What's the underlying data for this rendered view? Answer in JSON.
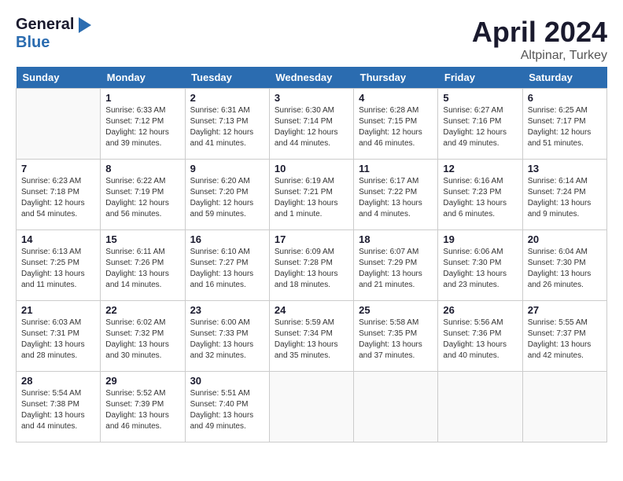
{
  "header": {
    "logo_general": "General",
    "logo_blue": "Blue",
    "title": "April 2024",
    "subtitle": "Altpinar, Turkey"
  },
  "calendar": {
    "days_of_week": [
      "Sunday",
      "Monday",
      "Tuesday",
      "Wednesday",
      "Thursday",
      "Friday",
      "Saturday"
    ],
    "weeks": [
      [
        {
          "day": "",
          "info": ""
        },
        {
          "day": "1",
          "sunrise": "Sunrise: 6:33 AM",
          "sunset": "Sunset: 7:12 PM",
          "daylight": "Daylight: 12 hours and 39 minutes."
        },
        {
          "day": "2",
          "sunrise": "Sunrise: 6:31 AM",
          "sunset": "Sunset: 7:13 PM",
          "daylight": "Daylight: 12 hours and 41 minutes."
        },
        {
          "day": "3",
          "sunrise": "Sunrise: 6:30 AM",
          "sunset": "Sunset: 7:14 PM",
          "daylight": "Daylight: 12 hours and 44 minutes."
        },
        {
          "day": "4",
          "sunrise": "Sunrise: 6:28 AM",
          "sunset": "Sunset: 7:15 PM",
          "daylight": "Daylight: 12 hours and 46 minutes."
        },
        {
          "day": "5",
          "sunrise": "Sunrise: 6:27 AM",
          "sunset": "Sunset: 7:16 PM",
          "daylight": "Daylight: 12 hours and 49 minutes."
        },
        {
          "day": "6",
          "sunrise": "Sunrise: 6:25 AM",
          "sunset": "Sunset: 7:17 PM",
          "daylight": "Daylight: 12 hours and 51 minutes."
        }
      ],
      [
        {
          "day": "7",
          "sunrise": "Sunrise: 6:23 AM",
          "sunset": "Sunset: 7:18 PM",
          "daylight": "Daylight: 12 hours and 54 minutes."
        },
        {
          "day": "8",
          "sunrise": "Sunrise: 6:22 AM",
          "sunset": "Sunset: 7:19 PM",
          "daylight": "Daylight: 12 hours and 56 minutes."
        },
        {
          "day": "9",
          "sunrise": "Sunrise: 6:20 AM",
          "sunset": "Sunset: 7:20 PM",
          "daylight": "Daylight: 12 hours and 59 minutes."
        },
        {
          "day": "10",
          "sunrise": "Sunrise: 6:19 AM",
          "sunset": "Sunset: 7:21 PM",
          "daylight": "Daylight: 13 hours and 1 minute."
        },
        {
          "day": "11",
          "sunrise": "Sunrise: 6:17 AM",
          "sunset": "Sunset: 7:22 PM",
          "daylight": "Daylight: 13 hours and 4 minutes."
        },
        {
          "day": "12",
          "sunrise": "Sunrise: 6:16 AM",
          "sunset": "Sunset: 7:23 PM",
          "daylight": "Daylight: 13 hours and 6 minutes."
        },
        {
          "day": "13",
          "sunrise": "Sunrise: 6:14 AM",
          "sunset": "Sunset: 7:24 PM",
          "daylight": "Daylight: 13 hours and 9 minutes."
        }
      ],
      [
        {
          "day": "14",
          "sunrise": "Sunrise: 6:13 AM",
          "sunset": "Sunset: 7:25 PM",
          "daylight": "Daylight: 13 hours and 11 minutes."
        },
        {
          "day": "15",
          "sunrise": "Sunrise: 6:11 AM",
          "sunset": "Sunset: 7:26 PM",
          "daylight": "Daylight: 13 hours and 14 minutes."
        },
        {
          "day": "16",
          "sunrise": "Sunrise: 6:10 AM",
          "sunset": "Sunset: 7:27 PM",
          "daylight": "Daylight: 13 hours and 16 minutes."
        },
        {
          "day": "17",
          "sunrise": "Sunrise: 6:09 AM",
          "sunset": "Sunset: 7:28 PM",
          "daylight": "Daylight: 13 hours and 18 minutes."
        },
        {
          "day": "18",
          "sunrise": "Sunrise: 6:07 AM",
          "sunset": "Sunset: 7:29 PM",
          "daylight": "Daylight: 13 hours and 21 minutes."
        },
        {
          "day": "19",
          "sunrise": "Sunrise: 6:06 AM",
          "sunset": "Sunset: 7:30 PM",
          "daylight": "Daylight: 13 hours and 23 minutes."
        },
        {
          "day": "20",
          "sunrise": "Sunrise: 6:04 AM",
          "sunset": "Sunset: 7:30 PM",
          "daylight": "Daylight: 13 hours and 26 minutes."
        }
      ],
      [
        {
          "day": "21",
          "sunrise": "Sunrise: 6:03 AM",
          "sunset": "Sunset: 7:31 PM",
          "daylight": "Daylight: 13 hours and 28 minutes."
        },
        {
          "day": "22",
          "sunrise": "Sunrise: 6:02 AM",
          "sunset": "Sunset: 7:32 PM",
          "daylight": "Daylight: 13 hours and 30 minutes."
        },
        {
          "day": "23",
          "sunrise": "Sunrise: 6:00 AM",
          "sunset": "Sunset: 7:33 PM",
          "daylight": "Daylight: 13 hours and 32 minutes."
        },
        {
          "day": "24",
          "sunrise": "Sunrise: 5:59 AM",
          "sunset": "Sunset: 7:34 PM",
          "daylight": "Daylight: 13 hours and 35 minutes."
        },
        {
          "day": "25",
          "sunrise": "Sunrise: 5:58 AM",
          "sunset": "Sunset: 7:35 PM",
          "daylight": "Daylight: 13 hours and 37 minutes."
        },
        {
          "day": "26",
          "sunrise": "Sunrise: 5:56 AM",
          "sunset": "Sunset: 7:36 PM",
          "daylight": "Daylight: 13 hours and 40 minutes."
        },
        {
          "day": "27",
          "sunrise": "Sunrise: 5:55 AM",
          "sunset": "Sunset: 7:37 PM",
          "daylight": "Daylight: 13 hours and 42 minutes."
        }
      ],
      [
        {
          "day": "28",
          "sunrise": "Sunrise: 5:54 AM",
          "sunset": "Sunset: 7:38 PM",
          "daylight": "Daylight: 13 hours and 44 minutes."
        },
        {
          "day": "29",
          "sunrise": "Sunrise: 5:52 AM",
          "sunset": "Sunset: 7:39 PM",
          "daylight": "Daylight: 13 hours and 46 minutes."
        },
        {
          "day": "30",
          "sunrise": "Sunrise: 5:51 AM",
          "sunset": "Sunset: 7:40 PM",
          "daylight": "Daylight: 13 hours and 49 minutes."
        },
        {
          "day": "",
          "info": ""
        },
        {
          "day": "",
          "info": ""
        },
        {
          "day": "",
          "info": ""
        },
        {
          "day": "",
          "info": ""
        }
      ]
    ]
  }
}
